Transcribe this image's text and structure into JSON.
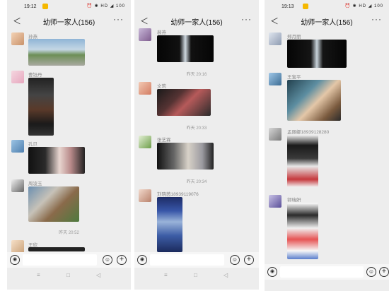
{
  "p1": {
    "time": "19:12",
    "status": "⏰ ✱ HD ◢ 100",
    "title": "幼师一家人(156)",
    "names": [
      "孙燕",
      "曹钰丹",
      "孔贝",
      "周凌玉",
      "王欣"
    ],
    "ts": "昨天 20:52"
  },
  "p2": {
    "title": "幼师一家人(156)",
    "names": [
      "裴燕",
      "文莉",
      "张艺霖",
      "刘晓茜18939119076"
    ],
    "ts": [
      "昨天 20:16",
      "昨天 20:33",
      "昨天 20:34"
    ]
  },
  "p3": {
    "time": "19:13",
    "status": "⏰ ✱ HD ◢ 100",
    "title": "幼师一家人(156)",
    "names": [
      "郑月丽",
      "王宝平",
      "孟丽娜18939128280",
      "郭瑞妍"
    ]
  },
  "icons": {
    "back": "chevron-left-icon",
    "more": "more-icon",
    "voice": "voice-icon",
    "emoji": "emoji-icon",
    "plus": "plus-icon"
  },
  "glyphs": {
    "back": "＜",
    "more": "···",
    "voice": "◉",
    "emoji": "☺",
    "plus": "+",
    "menu": "≡",
    "home": "□",
    "nav_back": "◁"
  }
}
